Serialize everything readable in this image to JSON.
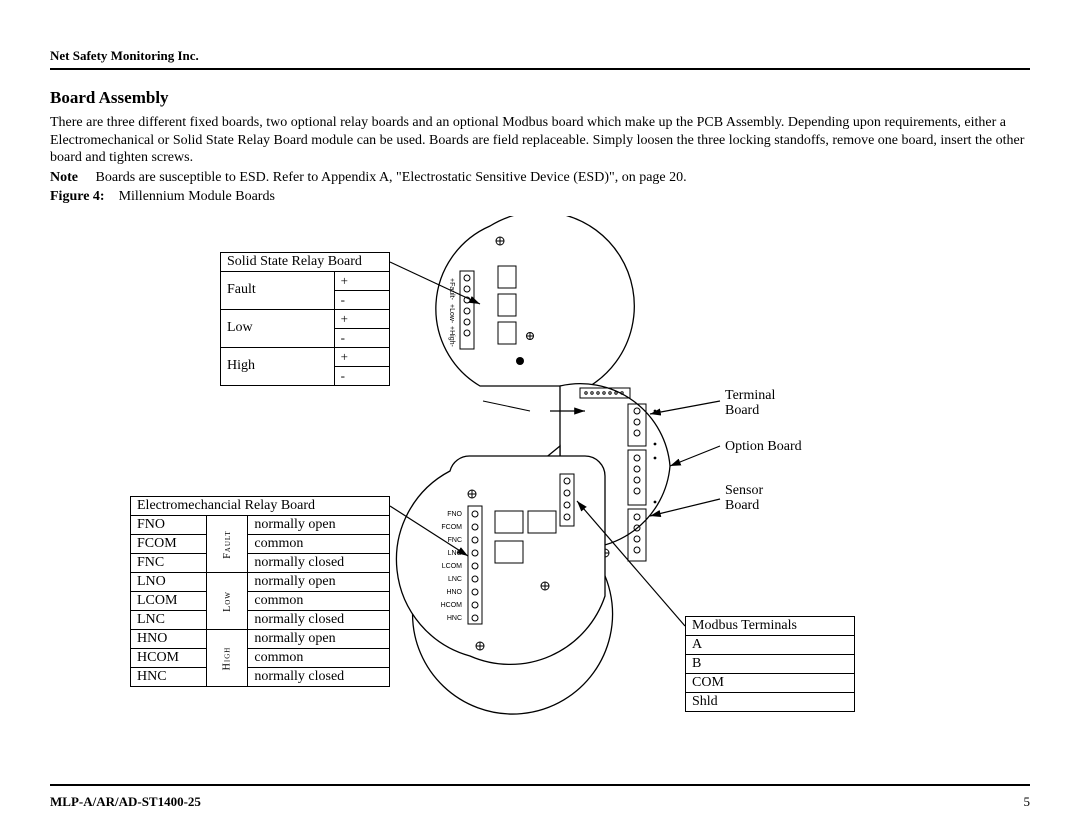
{
  "header": {
    "company": "Net Safety Monitoring Inc."
  },
  "section": {
    "heading": "Board Assembly",
    "para1": "There are three different fixed boards, two optional relay boards and an optional Modbus board which make up the PCB Assembly. Depending upon requirements, either a Electromechanical or Solid State Relay Board module can be used. Boards are field replaceable. Simply loosen the three locking standoffs, remove one board, insert the other board and tighten screws.",
    "note_label": "Note",
    "note_body": "Boards are susceptible to ESD. Refer to Appendix A, \"Electrostatic Sensitive Device (ESD)\", on page 20.",
    "figure_label": "Figure 4:",
    "figure_title": "Millennium Module Boards"
  },
  "ssr": {
    "title": "Solid State Relay Board",
    "rows": [
      {
        "label": "Fault",
        "a": "+",
        "b": "-"
      },
      {
        "label": "Low",
        "a": "+",
        "b": "-"
      },
      {
        "label": "High",
        "a": "+",
        "b": "-"
      }
    ]
  },
  "emr": {
    "title": "Electromechancial  Relay Board",
    "groups": [
      {
        "group": "Fault",
        "rows": [
          {
            "code": "FNO",
            "desc": "normally open"
          },
          {
            "code": "FCOM",
            "desc": "common"
          },
          {
            "code": "FNC",
            "desc": "normally closed"
          }
        ]
      },
      {
        "group": "Low",
        "rows": [
          {
            "code": "LNO",
            "desc": "normally open"
          },
          {
            "code": "LCOM",
            "desc": "common"
          },
          {
            "code": "LNC",
            "desc": "normally closed"
          }
        ]
      },
      {
        "group": "High",
        "rows": [
          {
            "code": "HNO",
            "desc": "normally open"
          },
          {
            "code": "HCOM",
            "desc": "common"
          },
          {
            "code": "HNC",
            "desc": "normally closed"
          }
        ]
      }
    ]
  },
  "modbus": {
    "title": "Modbus Terminals",
    "rows": [
      "A",
      "B",
      "COM",
      "Shld"
    ]
  },
  "callouts": {
    "terminal": "Terminal Board",
    "option": "Option Board",
    "sensor": "Sensor Board"
  },
  "pcb_labels": {
    "top": [
      "+Fault-",
      "+Low-",
      "+High-"
    ],
    "emr": [
      "FNO",
      "FCOM",
      "FNC",
      "LNO",
      "LCOM",
      "LNC",
      "HNO",
      "HCOM",
      "HNC"
    ]
  },
  "footer": {
    "doc_id": "MLP-A/AR/AD-ST1400-25",
    "page": "5"
  }
}
